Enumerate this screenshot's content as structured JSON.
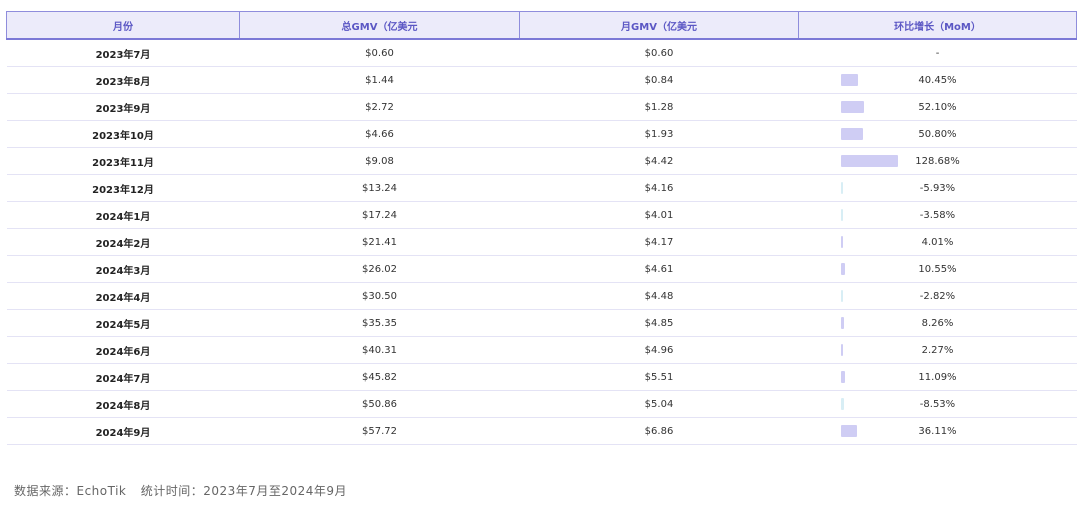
{
  "chart_data": {
    "type": "table",
    "columns": [
      "月份",
      "总GMV（亿美元",
      "月GMV（亿美元",
      "环比增长（MoM）"
    ],
    "rows": [
      {
        "month": "2023年7月",
        "total_gmv": "$0.60",
        "monthly_gmv": "$0.60",
        "mom": "-",
        "mom_value": null
      },
      {
        "month": "2023年8月",
        "total_gmv": "$1.44",
        "monthly_gmv": "$0.84",
        "mom": "40.45%",
        "mom_value": 40.45
      },
      {
        "month": "2023年9月",
        "total_gmv": "$2.72",
        "monthly_gmv": "$1.28",
        "mom": "52.10%",
        "mom_value": 52.1
      },
      {
        "month": "2023年10月",
        "total_gmv": "$4.66",
        "monthly_gmv": "$1.93",
        "mom": "50.80%",
        "mom_value": 50.8
      },
      {
        "month": "2023年11月",
        "total_gmv": "$9.08",
        "monthly_gmv": "$4.42",
        "mom": "128.68%",
        "mom_value": 128.68
      },
      {
        "month": "2023年12月",
        "total_gmv": "$13.24",
        "monthly_gmv": "$4.16",
        "mom": "-5.93%",
        "mom_value": -5.93
      },
      {
        "month": "2024年1月",
        "total_gmv": "$17.24",
        "monthly_gmv": "$4.01",
        "mom": "-3.58%",
        "mom_value": -3.58
      },
      {
        "month": "2024年2月",
        "total_gmv": "$21.41",
        "monthly_gmv": "$4.17",
        "mom": "4.01%",
        "mom_value": 4.01
      },
      {
        "month": "2024年3月",
        "total_gmv": "$26.02",
        "monthly_gmv": "$4.61",
        "mom": "10.55%",
        "mom_value": 10.55
      },
      {
        "month": "2024年4月",
        "total_gmv": "$30.50",
        "monthly_gmv": "$4.48",
        "mom": "-2.82%",
        "mom_value": -2.82
      },
      {
        "month": "2024年5月",
        "total_gmv": "$35.35",
        "monthly_gmv": "$4.85",
        "mom": "8.26%",
        "mom_value": 8.26
      },
      {
        "month": "2024年6月",
        "total_gmv": "$40.31",
        "monthly_gmv": "$4.96",
        "mom": "2.27%",
        "mom_value": 2.27
      },
      {
        "month": "2024年7月",
        "total_gmv": "$45.82",
        "monthly_gmv": "$5.51",
        "mom": "11.09%",
        "mom_value": 11.09
      },
      {
        "month": "2024年8月",
        "total_gmv": "$50.86",
        "monthly_gmv": "$5.04",
        "mom": "-8.53%",
        "mom_value": -8.53
      },
      {
        "month": "2024年9月",
        "total_gmv": "$57.72",
        "monthly_gmv": "$6.86",
        "mom": "36.11%",
        "mom_value": 36.11
      }
    ]
  },
  "footer": {
    "source": "数据来源：EchoTik",
    "period": "统计时间：2023年7月至2024年9月"
  },
  "colors": {
    "header_text": "#5b57c4",
    "header_bg": "#ecebfa",
    "bar_positive": "#cfcdf4",
    "bar_negative": "#d8eef5"
  }
}
